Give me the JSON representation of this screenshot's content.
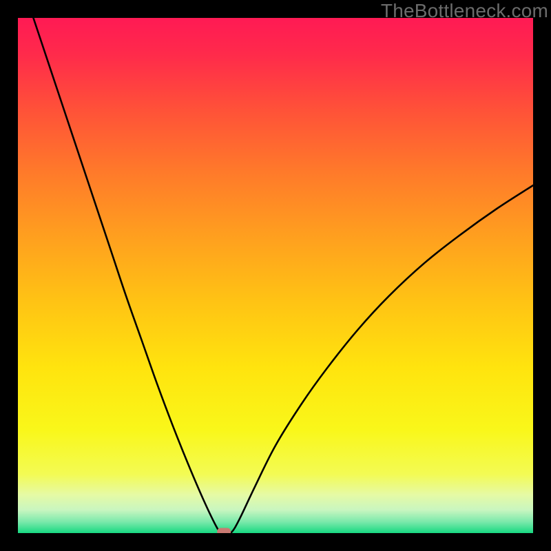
{
  "watermark": "TheBottleneck.com",
  "chart_data": {
    "type": "line",
    "title": "",
    "xlabel": "",
    "ylabel": "",
    "xlim": [
      0,
      100
    ],
    "ylim": [
      0,
      100
    ],
    "grid": false,
    "legend": false,
    "series": [
      {
        "name": "bottleneck-curve",
        "x": [
          3,
          6,
          9,
          12,
          15,
          18,
          21,
          24,
          27,
          30,
          33,
          36,
          38.5,
          39.5,
          40.5,
          41.5,
          43,
          46,
          50,
          55,
          60,
          66,
          72,
          79,
          86,
          93,
          100
        ],
        "y": [
          100,
          91,
          82,
          73,
          64,
          55,
          46,
          37.5,
          29,
          21,
          13.5,
          6.5,
          1.3,
          0,
          0,
          0.2,
          2.7,
          9,
          17,
          25,
          32,
          39.5,
          46,
          52.5,
          58,
          63,
          67.5
        ]
      }
    ],
    "marker": {
      "x": 40,
      "y": 0
    },
    "gradient_stops": [
      {
        "pos": 0.0,
        "color": "#ff1a54"
      },
      {
        "pos": 0.07,
        "color": "#ff2a4b"
      },
      {
        "pos": 0.18,
        "color": "#ff5238"
      },
      {
        "pos": 0.3,
        "color": "#ff7a2a"
      },
      {
        "pos": 0.42,
        "color": "#ff9e1f"
      },
      {
        "pos": 0.55,
        "color": "#ffc314"
      },
      {
        "pos": 0.68,
        "color": "#ffe40e"
      },
      {
        "pos": 0.8,
        "color": "#f9f71a"
      },
      {
        "pos": 0.885,
        "color": "#f3fb53"
      },
      {
        "pos": 0.925,
        "color": "#e6faa4"
      },
      {
        "pos": 0.955,
        "color": "#c9f6c0"
      },
      {
        "pos": 0.978,
        "color": "#7be9ab"
      },
      {
        "pos": 1.0,
        "color": "#17d981"
      }
    ],
    "curve_color": "#000000",
    "marker_color": "#c97a72",
    "frame": {
      "border_px": 26,
      "border_color": "#000000"
    }
  }
}
